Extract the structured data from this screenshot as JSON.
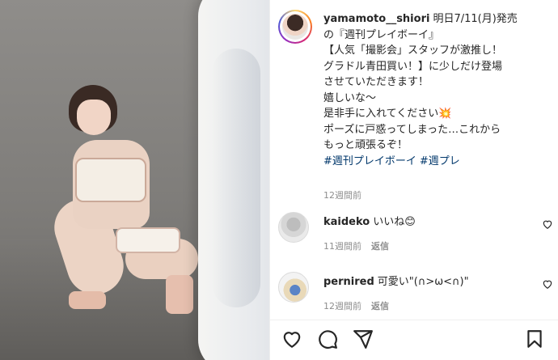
{
  "post": {
    "username": "yamamoto__shiori",
    "caption_lines": [
      "明日7/11(月)発売",
      "の『週刊プレイボーイ』",
      "【人気「撮影会」スタッフが激推し！",
      "グラドル青田買い！】に少しだけ登場",
      "させていただきます！",
      "嬉しいな〜",
      "是非手に入れてください",
      "ポーズに戸惑ってしまった…これから",
      "もっと頑張るぞ！"
    ],
    "emoji_sparkle": "💥",
    "hashtags": [
      "#週刊プレイボーイ",
      "#週プレ"
    ],
    "timestamp": "12週間前"
  },
  "comments": [
    {
      "username": "kaideko",
      "text": "いいね",
      "emoji": "😊",
      "timestamp": "11週間前",
      "reply_label": "返信"
    },
    {
      "username": "pernired",
      "text": "可愛い\"(∩>ω<∩)\"",
      "emoji": "",
      "timestamp": "12週間前",
      "reply_label": "返信"
    }
  ],
  "actions": {
    "icons": [
      "heart-icon",
      "comment-icon",
      "share-icon",
      "bookmark-icon"
    ]
  },
  "colors": {
    "hashtag": "#00376b",
    "meta_gray": "#8e8e8e",
    "text": "#262626"
  }
}
